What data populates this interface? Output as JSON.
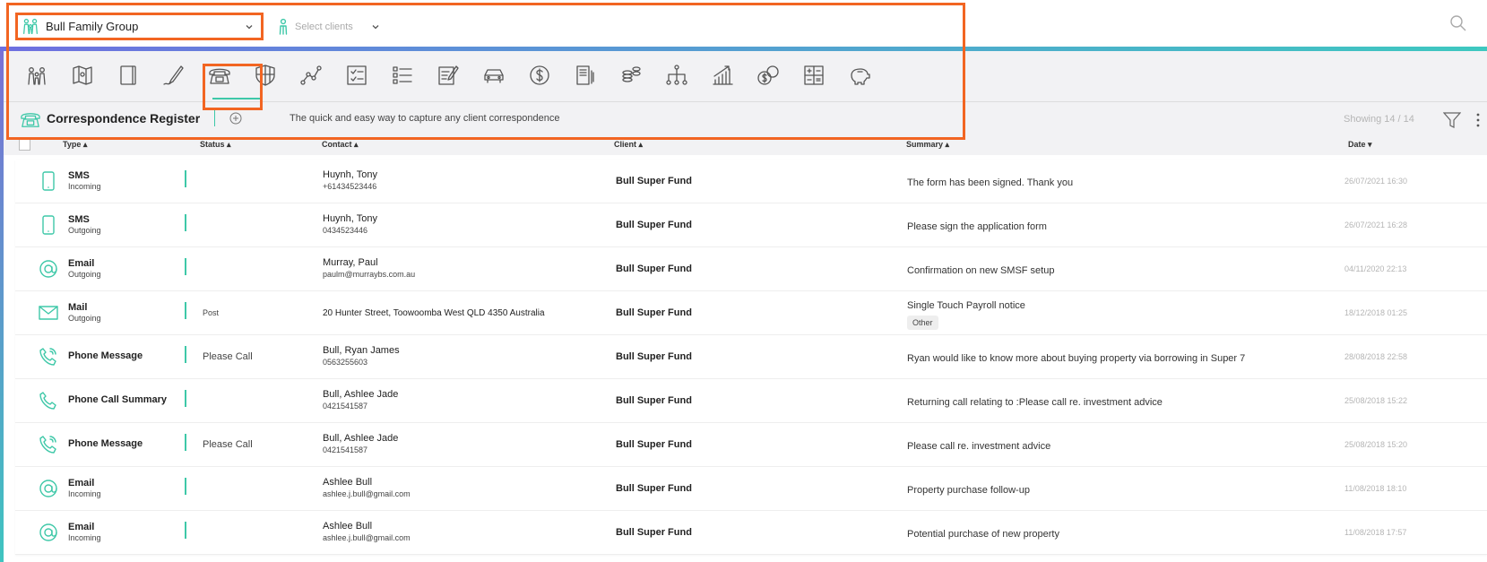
{
  "header": {
    "group_name": "Bull Family Group",
    "clients_placeholder": "Select clients"
  },
  "toolbar": {
    "tools": [
      "family-icon",
      "map-icon",
      "notebook-icon",
      "pen-icon",
      "telephone-icon",
      "shield-icon",
      "graph-icon",
      "checklist-icon",
      "list-icon",
      "edit-doc-icon",
      "car-icon",
      "dollar-icon",
      "documents-icon",
      "coins-icon",
      "hierarchy-icon",
      "growth-icon",
      "money-icon",
      "calculator-icon",
      "piggy-bank-icon"
    ],
    "active_tool": "telephone-icon"
  },
  "register": {
    "title": "Correspondence Register",
    "tagline": "The quick and easy way to capture any client correspondence",
    "showing": "Showing 14 / 14"
  },
  "columns": {
    "type": "Type",
    "status": "Status",
    "contact": "Contact",
    "client": "Client",
    "summary": "Summary",
    "date": "Date"
  },
  "rows": [
    {
      "icon": "mobile-icon",
      "type": "SMS",
      "direction": "Incoming",
      "status": "",
      "contact_name": "Huynh, Tony",
      "contact_detail": "+61434523446",
      "client": "Bull Super Fund",
      "summary": "The form has been signed. Thank you",
      "tag": "",
      "date": "26/07/2021 16:30"
    },
    {
      "icon": "mobile-icon",
      "type": "SMS",
      "direction": "Outgoing",
      "status": "",
      "contact_name": "Huynh, Tony",
      "contact_detail": "0434523446",
      "client": "Bull Super Fund",
      "summary": "Please sign the application form",
      "tag": "",
      "date": "26/07/2021 16:28"
    },
    {
      "icon": "at-icon",
      "type": "Email",
      "direction": "Outgoing",
      "status": "",
      "contact_name": "Murray, Paul",
      "contact_detail": "paulm@murraybs.com.au",
      "client": "Bull Super Fund",
      "summary": "Confirmation on new SMSF setup",
      "tag": "",
      "date": "04/11/2020 22:13"
    },
    {
      "icon": "envelope-icon",
      "type": "Mail",
      "direction": "Outgoing",
      "status": "Post",
      "contact_name": "20 Hunter Street, Toowoomba West QLD 4350 Australia",
      "contact_detail": "",
      "client": "Bull Super Fund",
      "summary": "Single Touch Payroll notice",
      "tag": "Other",
      "date": "18/12/2018 01:25"
    },
    {
      "icon": "phone-message-icon",
      "type": "Phone Message",
      "direction": "",
      "status": "Please Call",
      "contact_name": "Bull, Ryan James",
      "contact_detail": "0563255603",
      "client": "Bull Super Fund",
      "summary": "Ryan would like to know more about buying property via borrowing in Super 7",
      "tag": "",
      "date": "28/08/2018 22:58"
    },
    {
      "icon": "phone-icon",
      "type": "Phone Call Summary",
      "direction": "",
      "status": "",
      "contact_name": "Bull, Ashlee Jade",
      "contact_detail": "0421541587",
      "client": "Bull Super Fund",
      "summary": "Returning call relating to :Please call re. investment advice",
      "tag": "",
      "date": "25/08/2018 15:22"
    },
    {
      "icon": "phone-message-icon",
      "type": "Phone Message",
      "direction": "",
      "status": "Please Call",
      "contact_name": "Bull, Ashlee Jade",
      "contact_detail": "0421541587",
      "client": "Bull Super Fund",
      "summary": "Please call re. investment advice",
      "tag": "",
      "date": "25/08/2018 15:20"
    },
    {
      "icon": "at-icon",
      "type": "Email",
      "direction": "Incoming",
      "status": "",
      "contact_name": "Ashlee Bull",
      "contact_detail": "ashlee.j.bull@gmail.com",
      "client": "Bull Super Fund",
      "summary": "Property purchase follow-up",
      "tag": "",
      "date": "11/08/2018 18:10"
    },
    {
      "icon": "at-icon",
      "type": "Email",
      "direction": "Incoming",
      "status": "",
      "contact_name": "Ashlee Bull",
      "contact_detail": "ashlee.j.bull@gmail.com",
      "client": "Bull Super Fund",
      "summary": "Potential purchase of new property",
      "tag": "",
      "date": "11/08/2018 17:57"
    }
  ],
  "colors": {
    "accent": "#3ec8a8",
    "highlight": "#f26522"
  }
}
